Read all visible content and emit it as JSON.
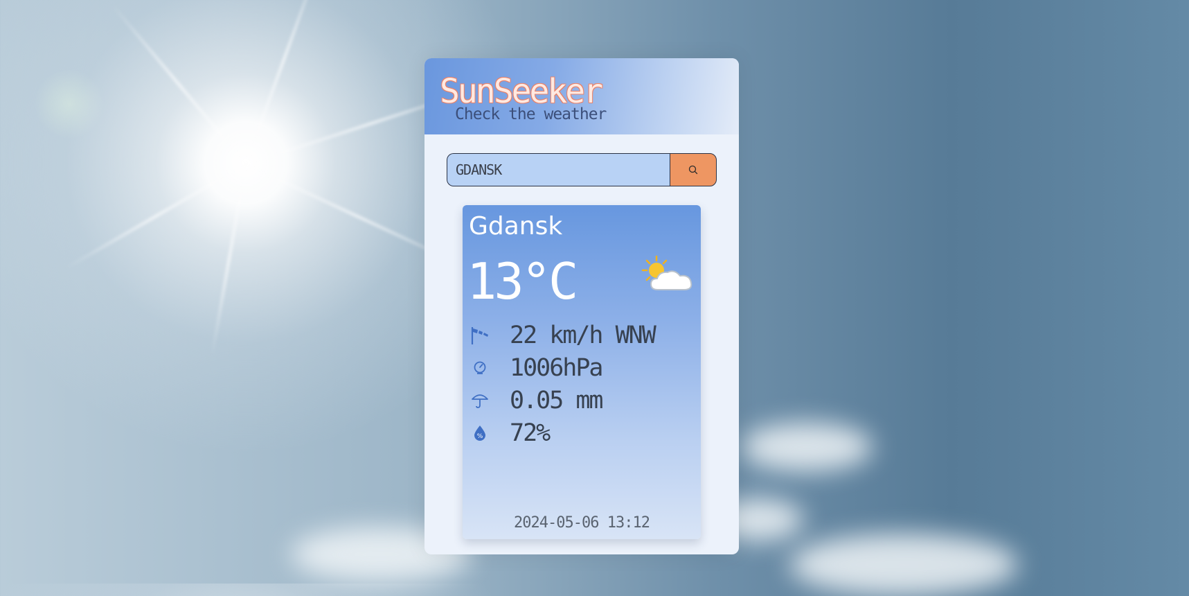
{
  "app": {
    "title": "SunSeeker",
    "subtitle": "Check the weather"
  },
  "search": {
    "value": "GDANSK",
    "button_icon": "search-icon"
  },
  "weather": {
    "city": "Gdansk",
    "temperature": "13°C",
    "condition_icon": "partly-cloudy-icon",
    "wind": "22 km/h WNW",
    "pressure": "1006hPa",
    "precipitation": "0.05 mm",
    "humidity": "72%",
    "updated": "2024-05-06 13:12"
  },
  "colors": {
    "accent": "#ee9662",
    "input_bg": "#b8d2f5",
    "card_top": "#6797df",
    "panel_bg": "#ecf2fb",
    "icon_blue": "#3f6fc4"
  }
}
